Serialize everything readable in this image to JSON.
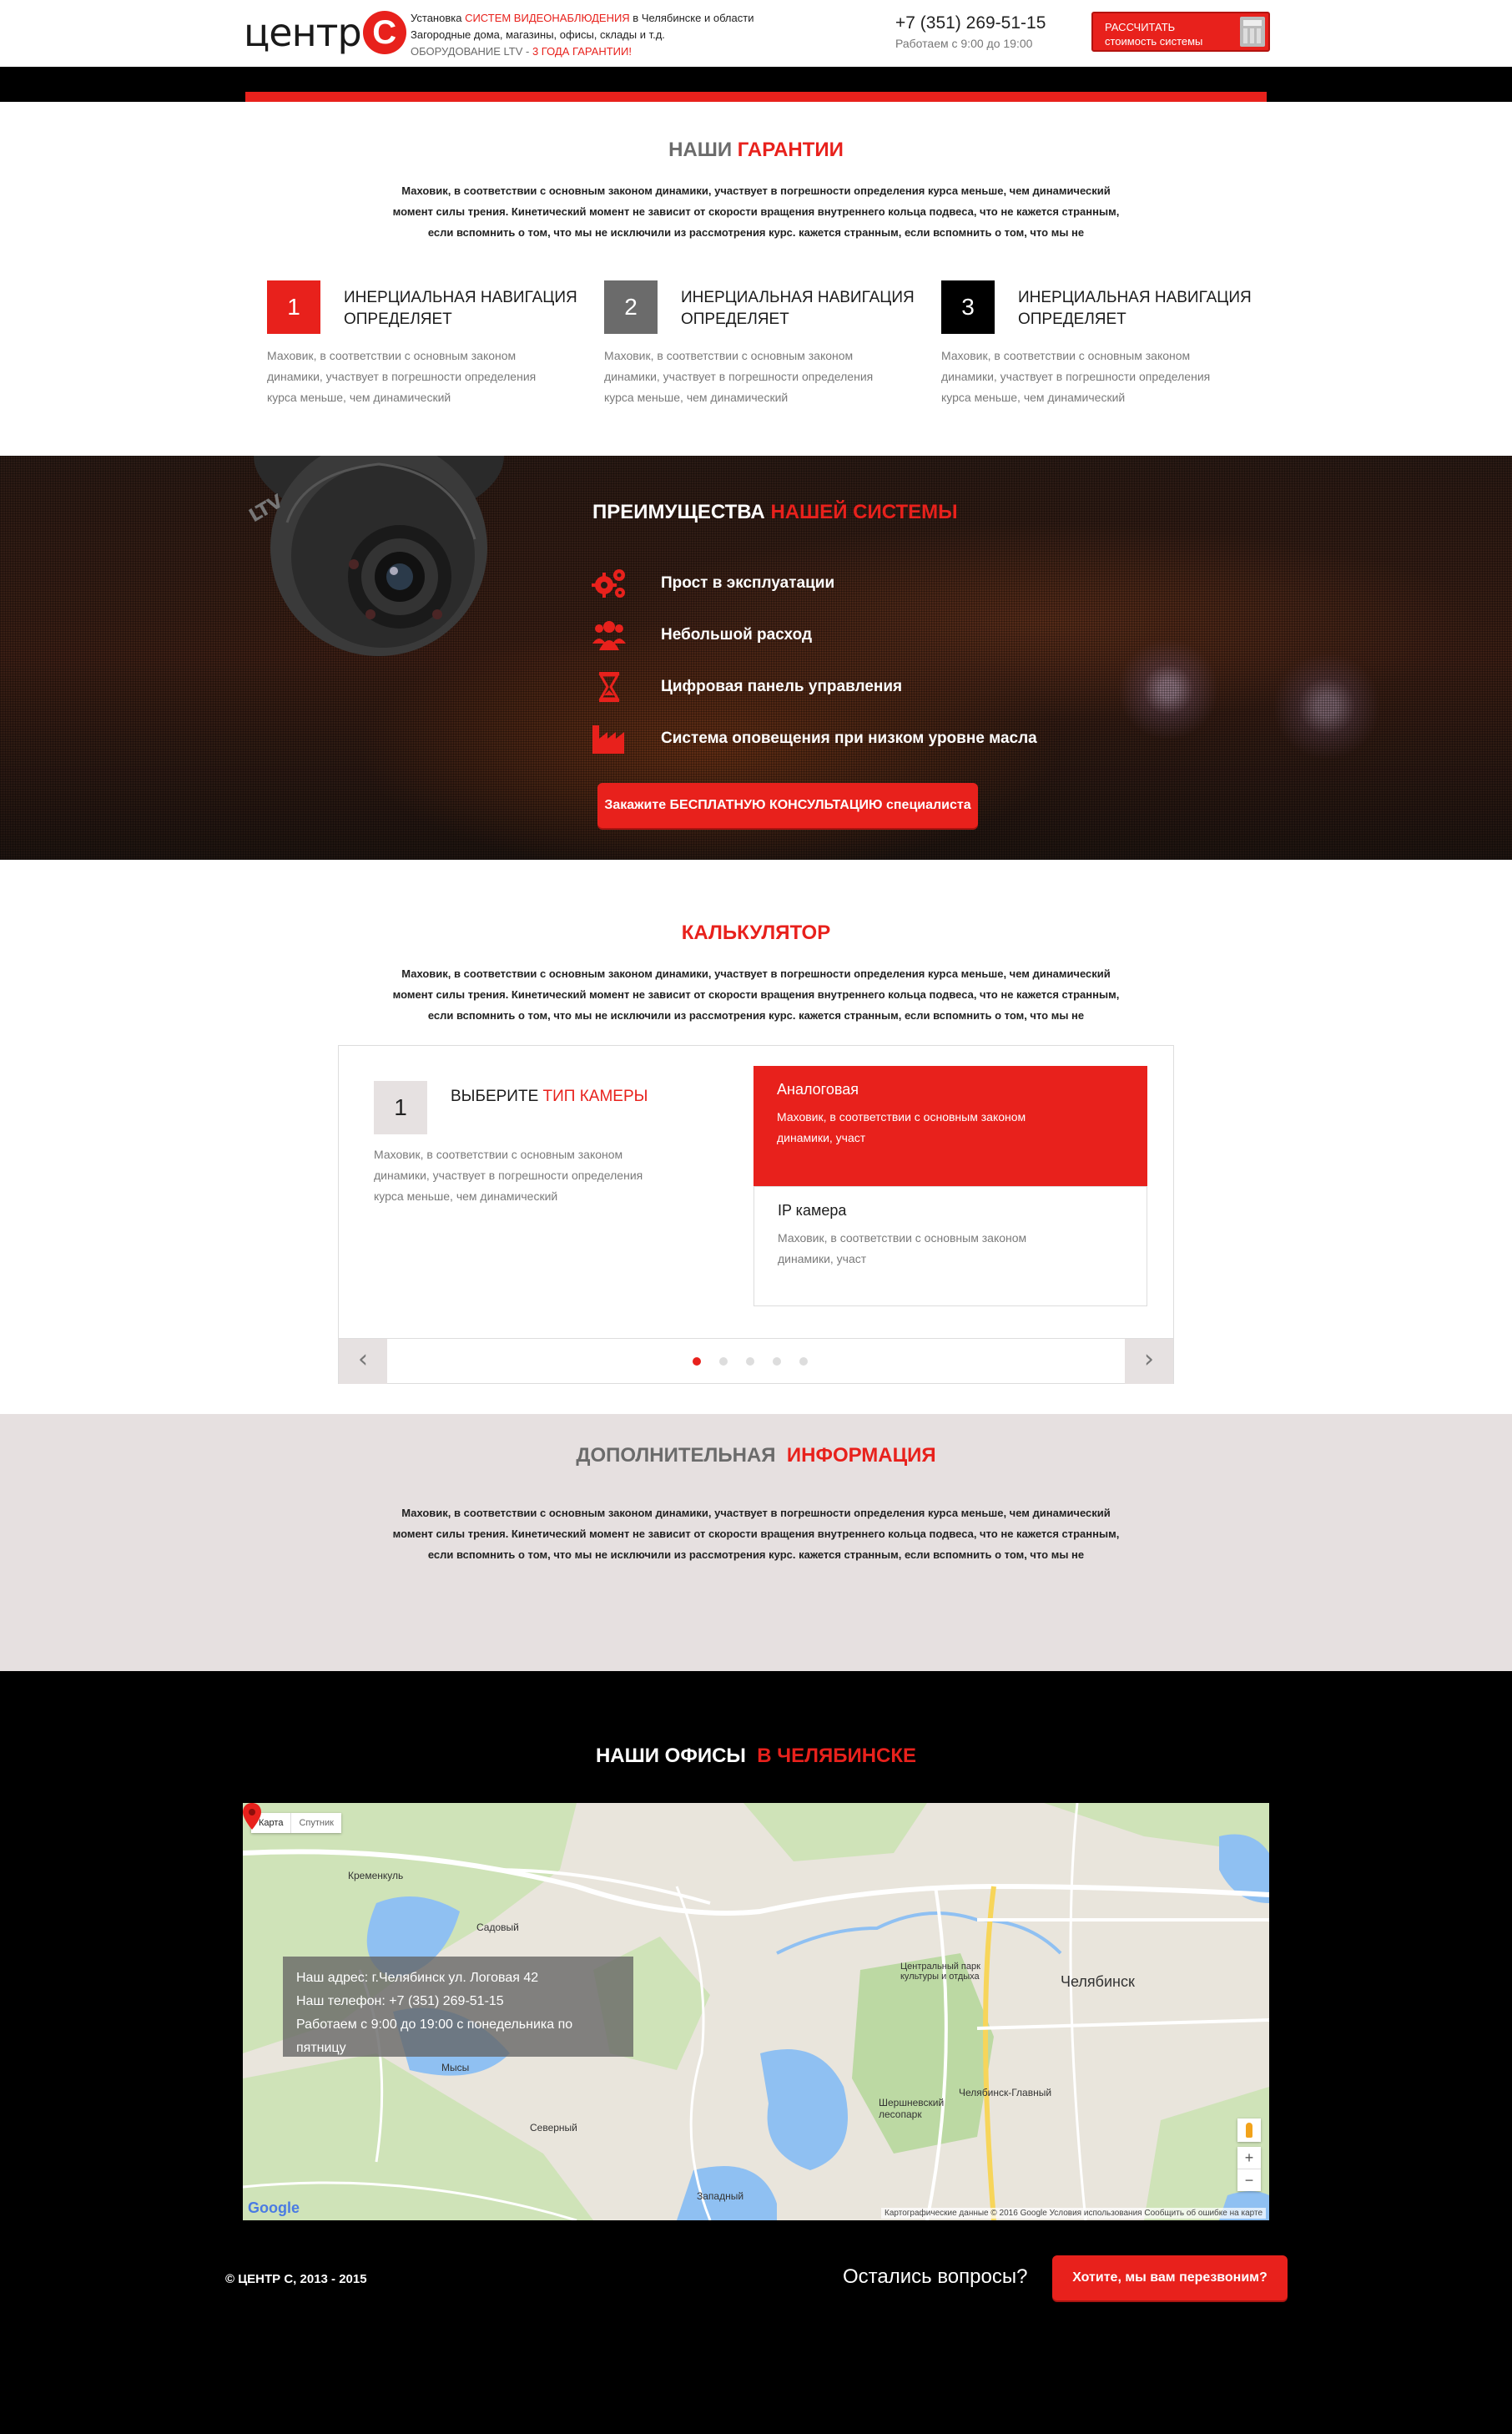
{
  "header": {
    "logo_word": "центр",
    "logo_letter": "С",
    "tagline_prefix": "Установка ",
    "tagline_highlight": "СИСТЕМ ВИДЕОНАБЛЮДЕНИЯ",
    "tagline_suffix": " в Челябинске и области",
    "tagline_line2": "Загородные дома, магазины, офисы, склады и т.д.",
    "tagline_line3_gray": "ОБОРУДОВАНИЕ LTV  -  ",
    "tagline_line3_red": "3 ГОДА ГАРАНТИИ!",
    "phone": "+7 (351) 269-51-15",
    "hours": "Работаем с 9:00 до 19:00",
    "calc_button_line1": "РАССЧИТАТЬ",
    "calc_button_line2": "стоимость  системы"
  },
  "guarantees": {
    "title_gray": "НАШИ ",
    "title_red": "ГАРАНТИИ",
    "text": "Маховик, в соответствии с основным законом динамики, участвует в погрешности определения курса меньше, чем динамический момент силы трения. Кинетический момент не зависит от скорости вращения внутреннего кольца подвеса, что не кажется странным, если вспомнить о том, что мы не исключили из рассмотрения курс. кажется странным, если вспомнить о том, что мы не",
    "items": [
      {
        "num": "1",
        "title": "ИНЕРЦИАЛЬНАЯ НАВИГАЦИЯ ОПРЕДЕЛЯЕТ",
        "text": "Маховик, в соответствии с основным законом динамики, участвует в погрешности определения курса меньше, чем динамический"
      },
      {
        "num": "2",
        "title": "ИНЕРЦИАЛЬНАЯ НАВИГАЦИЯ ОПРЕДЕЛЯЕТ",
        "text": "Маховик, в соответствии с основным законом динамики, участвует в погрешности определения курса меньше, чем динамический"
      },
      {
        "num": "3",
        "title": "ИНЕРЦИАЛЬНАЯ НАВИГАЦИЯ ОПРЕДЕЛЯЕТ",
        "text": "Маховик, в соответствии с основным законом динамики, участвует в погрешности определения курса меньше, чем динамический"
      }
    ],
    "num_colors": [
      "#e8211c",
      "#6b6b6b",
      "#000000"
    ]
  },
  "advantages": {
    "title_white": "ПРЕИМУЩЕСТВА ",
    "title_red": "НАШЕЙ СИСТЕМЫ",
    "items": [
      {
        "icon": "gears-icon",
        "label": "Прост в эксплуатации"
      },
      {
        "icon": "people-icon",
        "label": "Небольшой расход"
      },
      {
        "icon": "hourglass-icon",
        "label": "Цифровая панель управления"
      },
      {
        "icon": "factory-icon",
        "label": "Система оповещения при низком уровне масла"
      }
    ],
    "button": "Закажите БЕСПЛАТНУЮ КОНСУЛЬТАЦИЮ специалиста"
  },
  "calculator": {
    "title": "КАЛЬКУЛЯТОР",
    "text": "Маховик, в соответствии с основным законом динамики, участвует в погрешности определения курса меньше, чем динамический момент силы трения. Кинетический момент не зависит от скорости вращения внутреннего кольца подвеса, что не кажется странным, если вспомнить о том, что мы не исключили из рассмотрения курс. кажется странным, если вспомнить о том, что мы не",
    "step_num": "1",
    "step_title_dark": "ВЫБЕРИТЕ ",
    "step_title_red": "ТИП КАМЕРЫ",
    "step_text": "Маховик, в соответствии с основным законом динамики, участвует в погрешности определения курса меньше, чем динамический",
    "options": [
      {
        "title": "Аналоговая",
        "text": "Маховик, в соответствии с основным законом динамики, участ",
        "selected": true
      },
      {
        "title": "IP  камера",
        "text": "Маховик, в соответствии с основным законом динамики, участ",
        "selected": false
      }
    ],
    "prev": "‹",
    "next": "›",
    "dots_total": 5,
    "dot_active": 1
  },
  "info": {
    "title_gray": "ДОПОЛНИТЕЛЬНАЯ ",
    "title_red": "ИНФОРМАЦИЯ",
    "text": "Маховик, в соответствии с основным законом динамики, участвует в погрешности определения курса меньше, чем динамический момент силы трения. Кинетический момент не зависит от скорости вращения внутреннего кольца подвеса, что не кажется странным, если вспомнить о том, что мы не исключили из рассмотрения курс. кажется странным, если вспомнить о том, что мы не"
  },
  "offices": {
    "title_white": "НАШИ ОФИСЫ ",
    "title_red": "В ЧЕЛЯБИНСКЕ",
    "map_tab_map": "Карта",
    "map_tab_sat": "Спутник",
    "address": "Наш адрес: г.Челябинск ул. Логовая 42",
    "phone": "Наш телефон: +7 (351) 269-51-15",
    "hours": "Работаем с 9:00 до 19:00 с понедельника по пятницу",
    "zoom_in": "+",
    "zoom_out": "−",
    "google": "Google",
    "map_copy": "Картографические данные © 2016 Google   Условия использования   Сообщить об ошибке на карте",
    "city": "Челябинск",
    "places": [
      "Кременкуль",
      "Садовый",
      "Мысы",
      "Северный",
      "Западный",
      "Шершневский лесопарк",
      "Челябинск-Главный",
      "Центральный парк культуры и отдыха"
    ]
  },
  "footer": {
    "copyright": "© ЦЕНТР С, 2013 - 2015",
    "questions": "Остались вопросы?",
    "callback": "Хотите, мы вам перезвоним?"
  },
  "colors": {
    "accent": "#e8211c",
    "gray": "#6b6b6b",
    "info_bg": "#e6e0e0"
  }
}
